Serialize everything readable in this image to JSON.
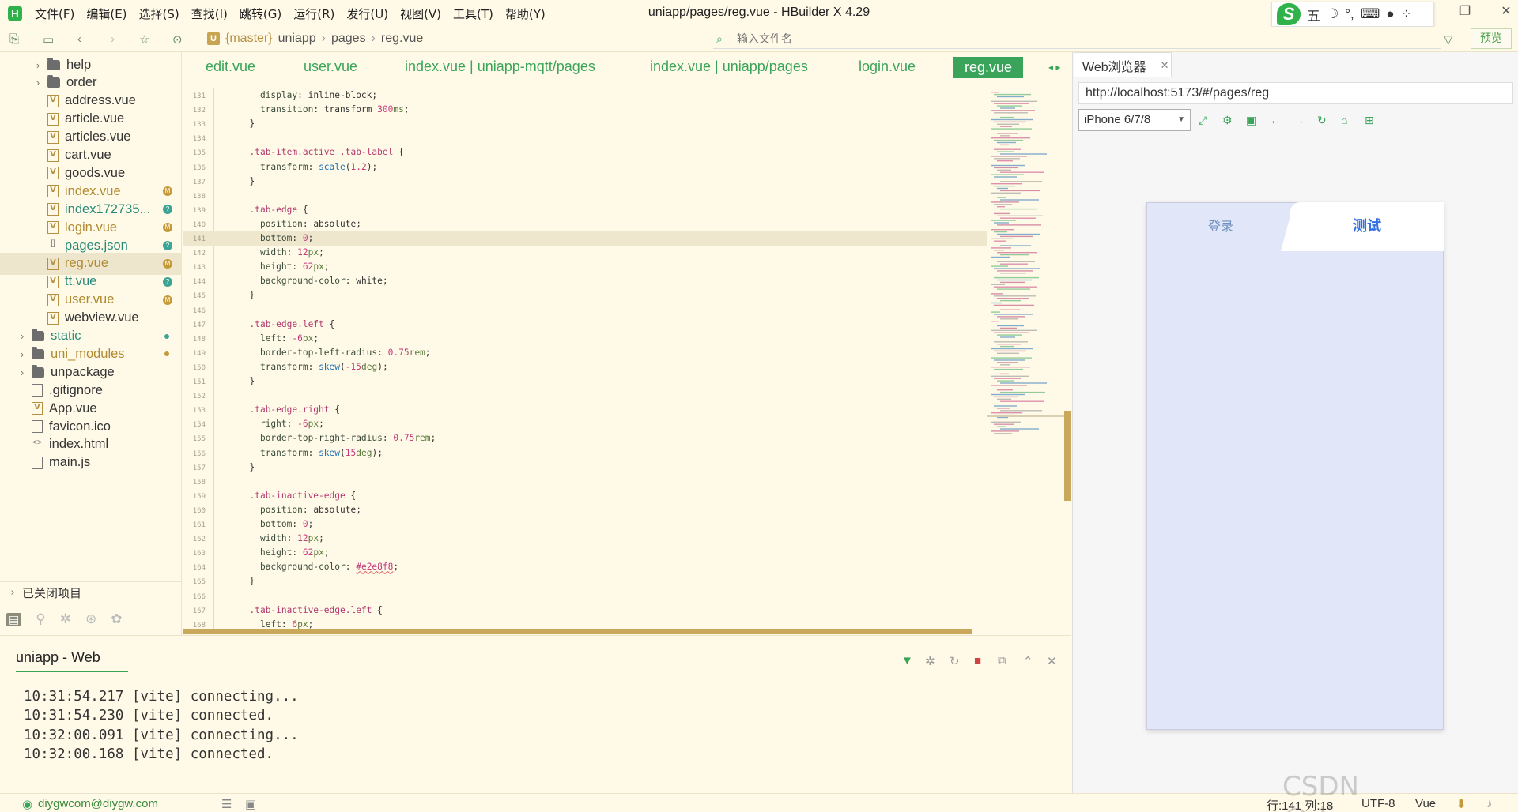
{
  "window": {
    "title": "uniapp/pages/reg.vue - HBuilder X 4.29",
    "logo": "H",
    "menu": [
      "文件(F)",
      "编辑(E)",
      "选择(S)",
      "查找(I)",
      "跳转(G)",
      "运行(R)",
      "发行(U)",
      "视图(V)",
      "工具(T)",
      "帮助(Y)"
    ]
  },
  "ime": {
    "logo": "S",
    "mode": "五",
    "moon": "☽",
    "punct": "°,",
    "kbd": "⌨"
  },
  "toolbar": {
    "breadcrumb": {
      "icon": "U",
      "branch": "{master}",
      "project": "uniapp",
      "folder": "pages",
      "file": "reg.vue"
    },
    "file_search_placeholder": "输入文件名",
    "preview_label": "预览"
  },
  "sidebar": {
    "items": [
      {
        "type": "folder",
        "label": "help",
        "depth": 2,
        "chev": "›"
      },
      {
        "type": "folder",
        "label": "order",
        "depth": 2,
        "chev": "›"
      },
      {
        "type": "vue",
        "label": "address.vue",
        "depth": 2
      },
      {
        "type": "vue",
        "label": "article.vue",
        "depth": 2
      },
      {
        "type": "vue",
        "label": "articles.vue",
        "depth": 2
      },
      {
        "type": "vue",
        "label": "cart.vue",
        "depth": 2
      },
      {
        "type": "vue",
        "label": "goods.vue",
        "depth": 2
      },
      {
        "type": "vue",
        "label": "index.vue",
        "depth": 2,
        "color": "gold",
        "badge": "M"
      },
      {
        "type": "vue",
        "label": "index172735...",
        "depth": 2,
        "color": "teal",
        "badge": "?"
      },
      {
        "type": "vue",
        "label": "login.vue",
        "depth": 2,
        "color": "gold",
        "badge": "M"
      },
      {
        "type": "json",
        "label": "pages.json",
        "depth": 2,
        "color": "teal",
        "badge": "?"
      },
      {
        "type": "vue",
        "label": "reg.vue",
        "depth": 2,
        "color": "gold",
        "badge": "M",
        "selected": true
      },
      {
        "type": "vue",
        "label": "tt.vue",
        "depth": 2,
        "color": "teal",
        "badge": "?"
      },
      {
        "type": "vue",
        "label": "user.vue",
        "depth": 2,
        "color": "gold",
        "badge": "M"
      },
      {
        "type": "vue",
        "label": "webview.vue",
        "depth": 2
      },
      {
        "type": "folder",
        "label": "static",
        "depth": 1,
        "chev": "›",
        "color": "teal",
        "dot": "#3ca494"
      },
      {
        "type": "folder",
        "label": "uni_modules",
        "depth": 1,
        "chev": "›",
        "color": "gold",
        "dot": "#c49a3a"
      },
      {
        "type": "folder",
        "label": "unpackage",
        "depth": 1,
        "chev": "›"
      },
      {
        "type": "file",
        "label": ".gitignore",
        "depth": 1
      },
      {
        "type": "vue",
        "label": "App.vue",
        "depth": 1
      },
      {
        "type": "file",
        "label": "favicon.ico",
        "depth": 1
      },
      {
        "type": "code",
        "label": "index.html",
        "depth": 1
      },
      {
        "type": "file",
        "label": "main.js",
        "depth": 1
      }
    ],
    "closed_projects": "已关闭项目"
  },
  "tabs": [
    {
      "label": "edit.vue"
    },
    {
      "label": "user.vue"
    },
    {
      "label": "index.vue | uniapp-mqtt/pages"
    },
    {
      "label": "index.vue | uniapp/pages"
    },
    {
      "label": "login.vue"
    },
    {
      "label": "reg.vue",
      "active": true
    }
  ],
  "code": [
    {
      "n": "131",
      "t": [
        [
          "    ",
          "p"
        ],
        [
          "display",
          "prop"
        ],
        [
          ": inline-block;",
          "p"
        ]
      ]
    },
    {
      "n": "132",
      "t": [
        [
          "    ",
          "p"
        ],
        [
          "transition",
          "prop"
        ],
        [
          ": transform ",
          "p"
        ],
        [
          "300",
          "num"
        ],
        [
          "ms",
          "unit"
        ],
        [
          ";",
          "p"
        ]
      ]
    },
    {
      "n": "133",
      "t": [
        [
          "  }",
          "p"
        ]
      ]
    },
    {
      "n": "134",
      "t": []
    },
    {
      "n": "135",
      "t": [
        [
          "  ",
          "p"
        ],
        [
          ".tab-item.active .tab-label",
          "sel"
        ],
        [
          " {",
          "p"
        ]
      ]
    },
    {
      "n": "136",
      "t": [
        [
          "    ",
          "p"
        ],
        [
          "transform",
          "prop"
        ],
        [
          ": ",
          "p"
        ],
        [
          "scale",
          "fn"
        ],
        [
          "(",
          "p"
        ],
        [
          "1.2",
          "num"
        ],
        [
          ");",
          "p"
        ]
      ]
    },
    {
      "n": "137",
      "t": [
        [
          "  }",
          "p"
        ]
      ]
    },
    {
      "n": "138",
      "t": []
    },
    {
      "n": "139",
      "t": [
        [
          "  ",
          "p"
        ],
        [
          ".tab-edge",
          "sel"
        ],
        [
          " {",
          "p"
        ]
      ]
    },
    {
      "n": "140",
      "t": [
        [
          "    ",
          "p"
        ],
        [
          "position",
          "prop"
        ],
        [
          ": absolute;",
          "p"
        ]
      ]
    },
    {
      "n": "141",
      "t": [
        [
          "    ",
          "p"
        ],
        [
          "bottom",
          "prop"
        ],
        [
          ": ",
          "p"
        ],
        [
          "0",
          "num"
        ],
        [
          ";",
          "p"
        ]
      ],
      "hl": true
    },
    {
      "n": "142",
      "t": [
        [
          "    ",
          "p"
        ],
        [
          "width",
          "prop"
        ],
        [
          ": ",
          "p"
        ],
        [
          "12",
          "num"
        ],
        [
          "px",
          "unit"
        ],
        [
          ";",
          "p"
        ]
      ]
    },
    {
      "n": "143",
      "t": [
        [
          "    ",
          "p"
        ],
        [
          "height",
          "prop"
        ],
        [
          ": ",
          "p"
        ],
        [
          "62",
          "num"
        ],
        [
          "px",
          "unit"
        ],
        [
          ";",
          "p"
        ]
      ]
    },
    {
      "n": "144",
      "t": [
        [
          "    ",
          "p"
        ],
        [
          "background-color",
          "prop"
        ],
        [
          ": white;",
          "p"
        ]
      ]
    },
    {
      "n": "145",
      "t": [
        [
          "  }",
          "p"
        ]
      ]
    },
    {
      "n": "146",
      "t": []
    },
    {
      "n": "147",
      "t": [
        [
          "  ",
          "p"
        ],
        [
          ".tab-edge.left",
          "sel"
        ],
        [
          " {",
          "p"
        ]
      ]
    },
    {
      "n": "148",
      "t": [
        [
          "    ",
          "p"
        ],
        [
          "left",
          "prop"
        ],
        [
          ": ",
          "p"
        ],
        [
          "-6",
          "num"
        ],
        [
          "px",
          "unit"
        ],
        [
          ";",
          "p"
        ]
      ]
    },
    {
      "n": "149",
      "t": [
        [
          "    ",
          "p"
        ],
        [
          "border-top-left-radius",
          "prop"
        ],
        [
          ": ",
          "p"
        ],
        [
          "0.75",
          "num"
        ],
        [
          "rem",
          "unit"
        ],
        [
          ";",
          "p"
        ]
      ]
    },
    {
      "n": "150",
      "t": [
        [
          "    ",
          "p"
        ],
        [
          "transform",
          "prop"
        ],
        [
          ": ",
          "p"
        ],
        [
          "skew",
          "fn"
        ],
        [
          "(",
          "p"
        ],
        [
          "-15",
          "num"
        ],
        [
          "deg",
          "unit"
        ],
        [
          ");",
          "p"
        ]
      ]
    },
    {
      "n": "151",
      "t": [
        [
          "  }",
          "p"
        ]
      ]
    },
    {
      "n": "152",
      "t": []
    },
    {
      "n": "153",
      "t": [
        [
          "  ",
          "p"
        ],
        [
          ".tab-edge.right",
          "sel"
        ],
        [
          " {",
          "p"
        ]
      ]
    },
    {
      "n": "154",
      "t": [
        [
          "    ",
          "p"
        ],
        [
          "right",
          "prop"
        ],
        [
          ": ",
          "p"
        ],
        [
          "-6",
          "num"
        ],
        [
          "px",
          "unit"
        ],
        [
          ";",
          "p"
        ]
      ]
    },
    {
      "n": "155",
      "t": [
        [
          "    ",
          "p"
        ],
        [
          "border-top-right-radius",
          "prop"
        ],
        [
          ": ",
          "p"
        ],
        [
          "0.75",
          "num"
        ],
        [
          "rem",
          "unit"
        ],
        [
          ";",
          "p"
        ]
      ]
    },
    {
      "n": "156",
      "t": [
        [
          "    ",
          "p"
        ],
        [
          "transform",
          "prop"
        ],
        [
          ": ",
          "p"
        ],
        [
          "skew",
          "fn"
        ],
        [
          "(",
          "p"
        ],
        [
          "15",
          "num"
        ],
        [
          "deg",
          "unit"
        ],
        [
          ");",
          "p"
        ]
      ]
    },
    {
      "n": "157",
      "t": [
        [
          "  }",
          "p"
        ]
      ]
    },
    {
      "n": "158",
      "t": []
    },
    {
      "n": "159",
      "t": [
        [
          "  ",
          "p"
        ],
        [
          ".tab-inactive-edge",
          "sel"
        ],
        [
          " {",
          "p"
        ]
      ]
    },
    {
      "n": "160",
      "t": [
        [
          "    ",
          "p"
        ],
        [
          "position",
          "prop"
        ],
        [
          ": absolute;",
          "p"
        ]
      ]
    },
    {
      "n": "161",
      "t": [
        [
          "    ",
          "p"
        ],
        [
          "bottom",
          "prop"
        ],
        [
          ": ",
          "p"
        ],
        [
          "0",
          "num"
        ],
        [
          ";",
          "p"
        ]
      ]
    },
    {
      "n": "162",
      "t": [
        [
          "    ",
          "p"
        ],
        [
          "width",
          "prop"
        ],
        [
          ": ",
          "p"
        ],
        [
          "12",
          "num"
        ],
        [
          "px",
          "unit"
        ],
        [
          ";",
          "p"
        ]
      ]
    },
    {
      "n": "163",
      "t": [
        [
          "    ",
          "p"
        ],
        [
          "height",
          "prop"
        ],
        [
          ": ",
          "p"
        ],
        [
          "62",
          "num"
        ],
        [
          "px",
          "unit"
        ],
        [
          ";",
          "p"
        ]
      ]
    },
    {
      "n": "164",
      "t": [
        [
          "    ",
          "p"
        ],
        [
          "background-color",
          "prop"
        ],
        [
          ": ",
          "p"
        ],
        [
          "#e2e8f8",
          "str"
        ],
        [
          ";",
          "p"
        ]
      ]
    },
    {
      "n": "165",
      "t": [
        [
          "  }",
          "p"
        ]
      ]
    },
    {
      "n": "166",
      "t": []
    },
    {
      "n": "167",
      "t": [
        [
          "  ",
          "p"
        ],
        [
          ".tab-inactive-edge.left",
          "sel"
        ],
        [
          " {",
          "p"
        ]
      ]
    },
    {
      "n": "168",
      "t": [
        [
          "    ",
          "p"
        ],
        [
          "left",
          "prop"
        ],
        [
          ": ",
          "p"
        ],
        [
          "6",
          "num"
        ],
        [
          "px",
          "unit"
        ],
        [
          ";",
          "p"
        ]
      ]
    }
  ],
  "console": {
    "tab_label": "uniapp - Web",
    "lines": [
      "10:31:54.217 [vite] connecting...",
      "10:31:54.230 [vite] connected.",
      "10:32:00.091 [vite] connecting...",
      "10:32:00.168 [vite] connected."
    ]
  },
  "statusbar": {
    "user": "diygwcom@diygw.com",
    "position": "行:141  列:18",
    "encoding": "UTF-8",
    "language": "Vue"
  },
  "browser": {
    "tab_label": "Web浏览器",
    "url": "http://localhost:5173/#/pages/reg",
    "device": "iPhone 6/7/8",
    "phone_tabs": {
      "login": "登录",
      "test": "测试"
    }
  },
  "watermark": "CSDN @diygwcom",
  "colors": {
    "accent": "#3aa55a",
    "background": "#fffae8",
    "phone_bg": "#e1e7f8",
    "active_tab_text": "#3470e0"
  }
}
